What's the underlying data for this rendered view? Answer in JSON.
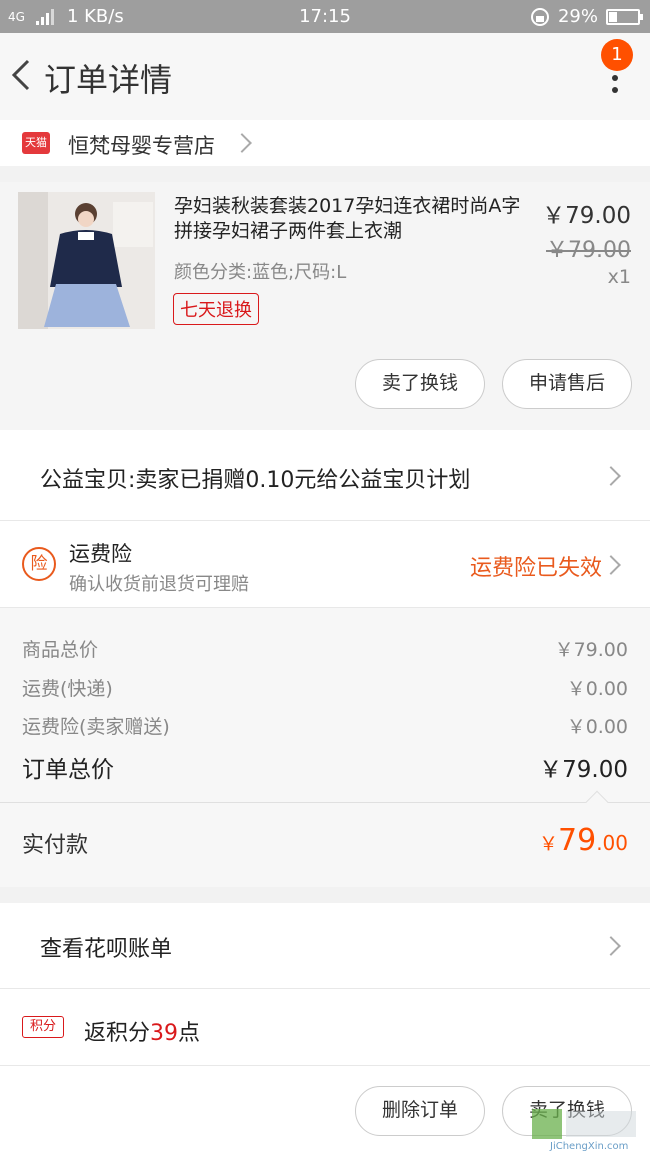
{
  "status_bar": {
    "network": "4G",
    "speed": "1 KB/s",
    "time": "17:15",
    "battery": "29%",
    "battery_level": 0.29
  },
  "header": {
    "title": "订单详情",
    "badge": "1"
  },
  "shop": {
    "badge": "天猫",
    "name": "恒梵母婴专营店"
  },
  "product": {
    "title": "孕妇装秋装套装2017孕妇连衣裙时尚A字拼接孕妇裙子两件套上衣潮",
    "sku": "颜色分类:蓝色;尺码:L",
    "tag": "七天退换",
    "price": "￥79.00",
    "original_price": "￥79.00",
    "quantity": "x1",
    "buttons": [
      "卖了换钱",
      "申请售后"
    ]
  },
  "charity": {
    "text": "公益宝贝:卖家已捐赠0.10元给公益宝贝计划"
  },
  "insurance": {
    "icon_text": "险",
    "title": "运费险",
    "subtitle": "确认收货前退货可理赔",
    "status": "运费险已失效"
  },
  "summary": {
    "rows": [
      {
        "label": "商品总价",
        "value": "￥79.00"
      },
      {
        "label": "运费(快递)",
        "value": "￥0.00"
      },
      {
        "label": "运费险(卖家赠送)",
        "value": "￥0.00"
      }
    ],
    "total_label": "订单总价",
    "total_value": "￥79.00"
  },
  "paid": {
    "label": "实付款",
    "currency": "￥",
    "integer": "79",
    "decimal": ".00"
  },
  "huabei": {
    "text": "查看花呗账单"
  },
  "points": {
    "badge": "积分",
    "prefix": "返积分",
    "number": "39",
    "suffix": "点"
  },
  "footer": {
    "buttons": [
      "删除订单",
      "卖了换钱"
    ]
  },
  "watermark": {
    "text": "JiChengXin.com"
  },
  "colors": {
    "accent": "#ff5000",
    "red": "#d9191b",
    "insurance": "#e95a1d"
  }
}
